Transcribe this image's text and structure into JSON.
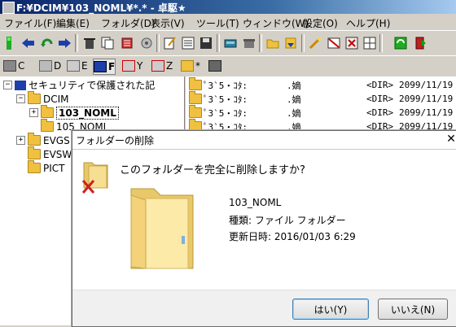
{
  "window": {
    "title": "F:¥DCIM¥103_NOML¥*.* - 卓駆★"
  },
  "menu": [
    "ファイル(F)",
    "編集(E)",
    "フォルダ(D)",
    "表示(V)",
    "ツール(T)",
    "ウィンドウ(W)",
    "設定(O)",
    "ヘルプ(H)"
  ],
  "toolbar_icons": [
    "new-icon",
    "back-icon",
    "refresh-icon",
    "forward-icon",
    "delete-icon",
    "copy-icon",
    "trash-icon",
    "settings-icon",
    "edit-icon",
    "list-icon",
    "floppy-icon",
    "disk-icon",
    "archive-icon",
    "folder-open-icon",
    "download-icon",
    "pencil-icon",
    "image-icon",
    "star-icon",
    "sync-icon",
    "exit-icon"
  ],
  "drives": [
    {
      "letter": "C",
      "icon": "drive-c-icon"
    },
    {
      "letter": "D",
      "icon": "drive-d-icon"
    },
    {
      "letter": "E",
      "icon": "drive-e-icon"
    },
    {
      "letter": "F",
      "icon": "drive-f-icon"
    },
    {
      "letter": "Y",
      "icon": "drive-y-icon"
    },
    {
      "letter": "Z",
      "icon": "drive-z-icon"
    },
    {
      "letter": "*",
      "icon": "drive-all-icon"
    },
    {
      "letter": "",
      "icon": "network-icon"
    }
  ],
  "tree": {
    "root": "セキュリティで保護された記",
    "dcim": "DCIM",
    "selected": "103_NOML",
    "sibling": "105_NOML",
    "others": [
      "EVGS",
      "EVSW",
      "PICT"
    ]
  },
  "files": [
    {
      "name": "ﾟ3`5・ｺﾀ:",
      "ext": ".嫡",
      "size": "<DIR>",
      "date": "2099/11/19"
    },
    {
      "name": "ﾟ3`5・ｺﾀ:",
      "ext": ".嫡",
      "size": "<DIR>",
      "date": "2099/11/19"
    },
    {
      "name": "ﾟ3`5・ｺﾀ:",
      "ext": ".嫡",
      "size": "<DIR>",
      "date": "2099/11/19"
    },
    {
      "name": "ﾟ3`5・ｺﾀ:",
      "ext": ".嫡",
      "size": "<DIR>",
      "date": "2099/11/19"
    }
  ],
  "dialog": {
    "title": "フォルダーの削除",
    "message": "このフォルダーを完全に削除しますか?",
    "name": "103_NOML",
    "type": "種類: ファイル フォルダー",
    "date": "更新日時: 2016/01/03 6:29",
    "yes": "はい(Y)",
    "no": "いいえ(N)"
  }
}
